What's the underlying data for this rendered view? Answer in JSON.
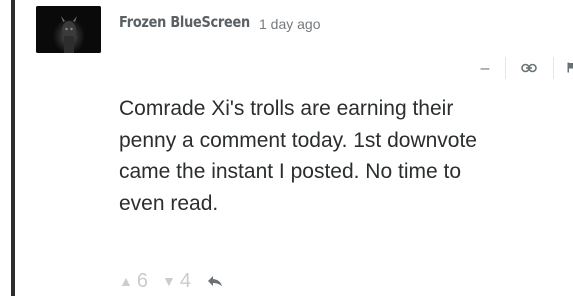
{
  "comment": {
    "author": "Frozen BlueScreen",
    "time": "1 day ago",
    "message": "Comrade Xi's trolls are earning their\npenny a comment today.  1st downvote\ncame the instant I posted.  No time to\neven read.",
    "upvotes": "6",
    "downvotes": "4"
  },
  "menu": {
    "collapse_label": "–",
    "link_icon": "link-icon",
    "flag_icon": "flag-icon"
  },
  "icons": {
    "upvote": "▲",
    "downvote": "▼",
    "reply": "reply-arrow-icon"
  },
  "colors": {
    "thread_line": "#2c2c2c",
    "author": "#5a6064",
    "text": "#2a2e2e",
    "muted": "#c9cdd0"
  }
}
